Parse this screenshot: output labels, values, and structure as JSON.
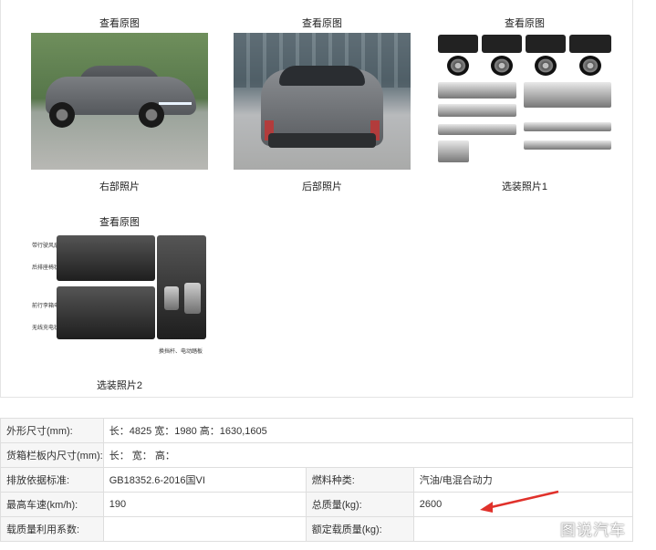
{
  "gallery": [
    {
      "view_label": "查看原图",
      "caption": "右部照片"
    },
    {
      "view_label": "查看原图",
      "caption": "后部照片"
    },
    {
      "view_label": "查看原图",
      "caption": "选装照片1"
    },
    {
      "view_label": "查看原图",
      "caption": "选装照片2"
    }
  ],
  "photo4_notes": [
    "带行驶风扇电动门",
    "后排座椅状态",
    "前行李箱电动后门",
    "无线充电状态",
    "换挡杆、电动踏板"
  ],
  "specs": {
    "row1": {
      "label": "外形尺寸(mm):",
      "value": "长：4825 宽：1980 高：1630,1605"
    },
    "row2": {
      "label": "货箱栏板内尺寸(mm):",
      "value": "长：  宽：  高："
    },
    "row3": {
      "label": "排放依据标准:",
      "value": "GB18352.6-2016国VI",
      "label2": "燃料种类:",
      "value2": "汽油/电混合动力"
    },
    "row4": {
      "label": "最高车速(km/h):",
      "value": "190",
      "label2": "总质量(kg):",
      "value2": "2600"
    },
    "row5": {
      "label": "载质量利用系数:",
      "value": "",
      "label2": "额定载质量(kg):",
      "value2": ""
    }
  },
  "watermark": "图说汽车",
  "colors": {
    "arrow": "#e0312b",
    "table_border": "#dedede",
    "label_bg": "#f6f6f6"
  }
}
